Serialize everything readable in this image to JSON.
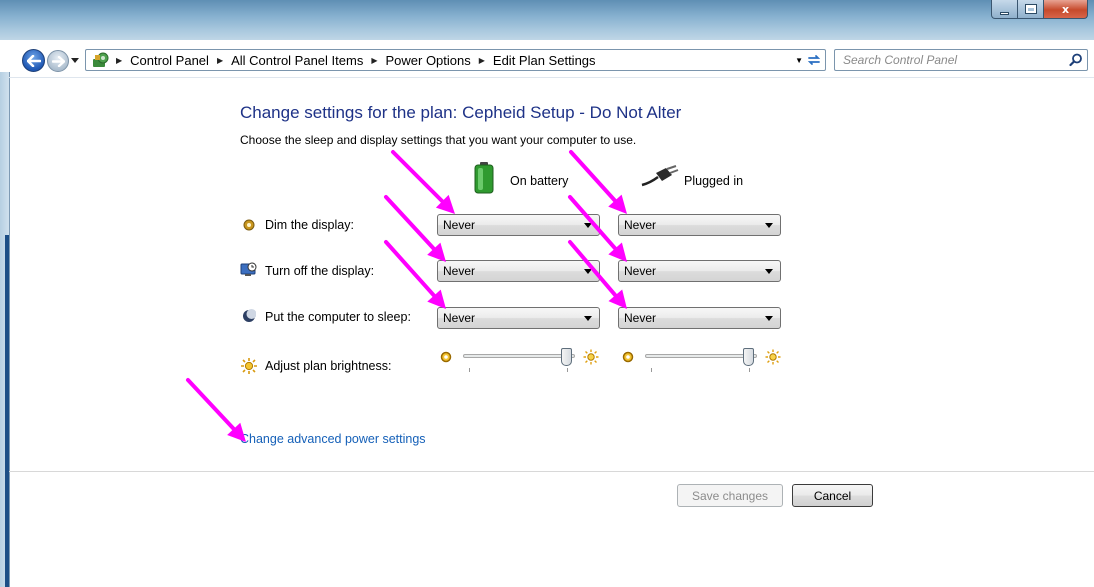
{
  "window": {
    "controls": {
      "close_label": "x"
    }
  },
  "navigation": {
    "breadcrumbs": [
      "Control Panel",
      "All Control Panel Items",
      "Power Options",
      "Edit Plan Settings"
    ],
    "search_placeholder": "Search Control Panel"
  },
  "content": {
    "title": "Change settings for the plan: Cepheid Setup - Do Not Alter",
    "subtitle": "Choose the sleep and display settings that you want your computer to use.",
    "columns": {
      "battery": "On battery",
      "plugged": "Plugged in"
    },
    "rows": [
      {
        "label": "Dim the display:",
        "battery_value": "Never",
        "plugged_value": "Never"
      },
      {
        "label": "Turn off the display:",
        "battery_value": "Never",
        "plugged_value": "Never"
      },
      {
        "label": "Put the computer to sleep:",
        "battery_value": "Never",
        "plugged_value": "Never"
      }
    ],
    "brightness": {
      "label": "Adjust plan brightness:",
      "battery_level": 1.0,
      "plugged_level": 1.0
    },
    "advanced_link": "Change advanced power settings"
  },
  "buttons": {
    "save": "Save changes",
    "cancel": "Cancel"
  },
  "colors": {
    "title": "#1e3287",
    "link": "#1560b8",
    "annotation_arrow": "#ff00ff"
  }
}
